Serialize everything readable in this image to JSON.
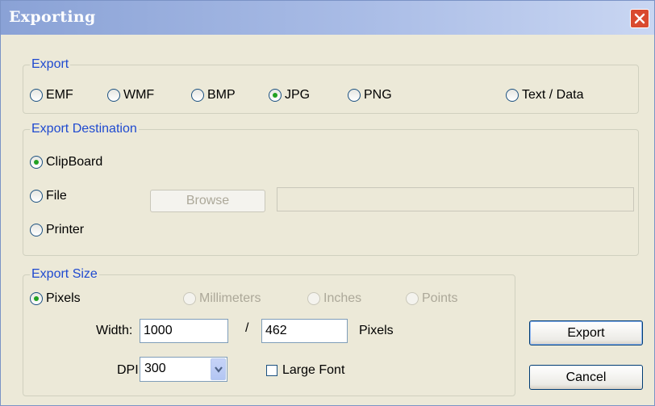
{
  "window": {
    "title": "Exporting"
  },
  "export_group": {
    "legend": "Export",
    "options": [
      "EMF",
      "WMF",
      "BMP",
      "JPG",
      "PNG",
      "Text / Data"
    ],
    "selected": "JPG"
  },
  "destination_group": {
    "legend": "Export Destination",
    "options": [
      "ClipBoard",
      "File",
      "Printer"
    ],
    "selected": "ClipBoard",
    "browse_label": "Browse",
    "file_path": ""
  },
  "size_group": {
    "legend": "Export Size",
    "units": [
      "Pixels",
      "Millimeters",
      "Inches",
      "Points"
    ],
    "selected_unit": "Pixels",
    "width_label": "Width:",
    "width_value": "1000",
    "separator": "/",
    "height_value": "462",
    "units_label": "Pixels",
    "dpi_label": "DPI:",
    "dpi_value": "300",
    "large_font_label": "Large Font",
    "large_font_checked": false
  },
  "buttons": {
    "export_label": "Export",
    "cancel_label": "Cancel"
  },
  "colors": {
    "title_start": "#8aa2d6",
    "title_end": "#c9d6f2",
    "close": "#d94a2f",
    "legend": "#1f4ad0",
    "radio_dot": "#21a121"
  }
}
